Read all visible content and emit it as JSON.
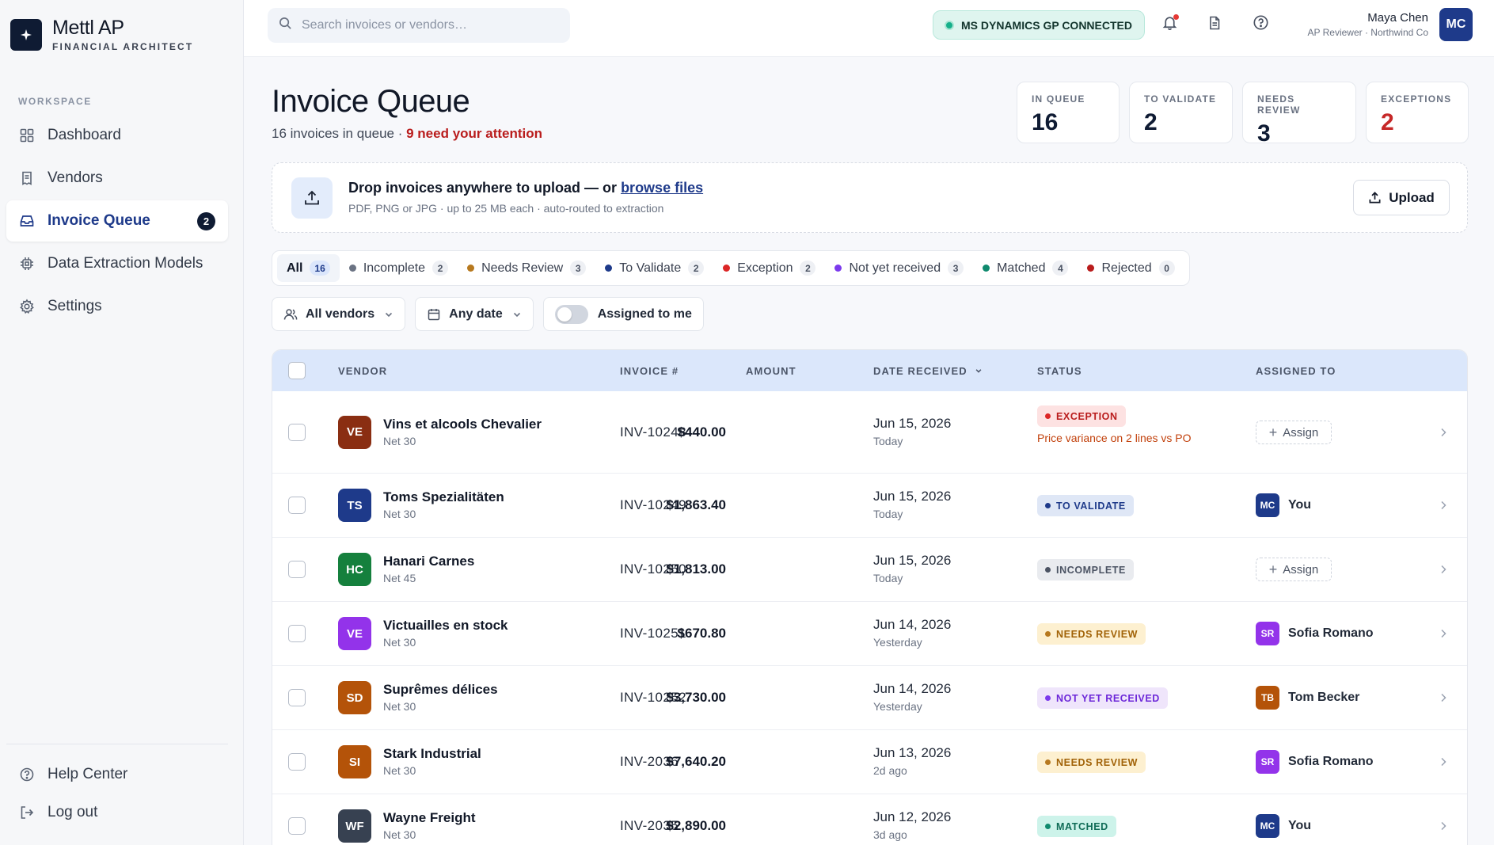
{
  "brand": {
    "name": "Mettl AP",
    "tagline": "FINANCIAL ARCHITECT"
  },
  "sidebar": {
    "section_label": "WORKSPACE",
    "items": [
      {
        "label": "Dashboard",
        "icon": "grid-icon"
      },
      {
        "label": "Vendors",
        "icon": "receipt-icon"
      },
      {
        "label": "Invoice Queue",
        "icon": "inbox-icon",
        "badge": "2",
        "active": true
      },
      {
        "label": "Data Extraction Models",
        "icon": "cpu-icon"
      },
      {
        "label": "Settings",
        "icon": "gear-icon"
      }
    ],
    "bottom": [
      {
        "label": "Help Center",
        "icon": "help-icon"
      },
      {
        "label": "Log out",
        "icon": "logout-icon"
      }
    ]
  },
  "topbar": {
    "search_placeholder": "Search invoices or vendors…",
    "connection": "MS DYNAMICS GP CONNECTED",
    "user": {
      "name": "Maya Chen",
      "role": "AP Reviewer · Northwind Co",
      "initials": "MC"
    }
  },
  "header": {
    "title": "Invoice Queue",
    "subtitle_count": "16 invoices in queue · ",
    "subtitle_attention": "9 need your attention"
  },
  "stats": [
    {
      "label": "IN QUEUE",
      "value": "16",
      "color": "#0f1b33"
    },
    {
      "label": "TO VALIDATE",
      "value": "2",
      "color": "#0f1b33"
    },
    {
      "label": "NEEDS REVIEW",
      "value": "3",
      "color": "#0f1b33"
    },
    {
      "label": "EXCEPTIONS",
      "value": "2",
      "color": "#c62828"
    }
  ],
  "upload": {
    "title": "Drop invoices anywhere to upload — or ",
    "link": "browse files",
    "subtitle": "PDF, PNG or JPG · up to 25 MB each · auto-routed to extraction",
    "button": "Upload"
  },
  "tabs": [
    {
      "label": "All",
      "count": "16",
      "active": true
    },
    {
      "label": "Incomplete",
      "count": "2",
      "dot": "#6b7383"
    },
    {
      "label": "Needs Review",
      "count": "3",
      "dot": "#b7791f"
    },
    {
      "label": "To Validate",
      "count": "2",
      "dot": "#1e3a8a"
    },
    {
      "label": "Exception",
      "count": "2",
      "dot": "#dc2626"
    },
    {
      "label": "Not yet received",
      "count": "3",
      "dot": "#7c3aed"
    },
    {
      "label": "Matched",
      "count": "4",
      "dot": "#0f8a6e"
    },
    {
      "label": "Rejected",
      "count": "0",
      "dot": "#b91c1c"
    }
  ],
  "filters": {
    "vendor": "All vendors",
    "date": "Any date",
    "assigned": "Assigned to me"
  },
  "table": {
    "columns": {
      "vendor": "VENDOR",
      "invoice": "INVOICE #",
      "amount": "AMOUNT",
      "date": "DATE RECEIVED",
      "status": "STATUS",
      "assigned": "ASSIGNED TO"
    },
    "assign_label": "Assign",
    "rows": [
      {
        "initials": "VE",
        "avatar_color": "#8a2e12",
        "vendor": "Vins et alcools Chevalier",
        "terms": "Net 30",
        "invoice": "INV-10248",
        "amount": "$440.00",
        "date": "Jun 15, 2026",
        "relative": "Today",
        "status": "EXCEPTION",
        "status_bg": "#fde2e2",
        "status_fg": "#b91c1c",
        "note": "Price variance on 2 lines vs PO",
        "assignee": null
      },
      {
        "initials": "TS",
        "avatar_color": "#1e3a8a",
        "vendor": "Toms Spezialitäten",
        "terms": "Net 30",
        "invoice": "INV-10249",
        "amount": "$1,863.40",
        "date": "Jun 15, 2026",
        "relative": "Today",
        "status": "TO VALIDATE",
        "status_bg": "#dfe7f6",
        "status_fg": "#1e3a8a",
        "assignee": {
          "initials": "MC",
          "name": "You",
          "color": "#1e3a8a"
        }
      },
      {
        "initials": "HC",
        "avatar_color": "#15803d",
        "vendor": "Hanari Carnes",
        "terms": "Net 45",
        "invoice": "INV-10250",
        "amount": "$1,813.00",
        "date": "Jun 15, 2026",
        "relative": "Today",
        "status": "INCOMPLETE",
        "status_bg": "#e9ebef",
        "status_fg": "#4b5363",
        "assignee": null
      },
      {
        "initials": "VE",
        "avatar_color": "#9333ea",
        "vendor": "Victuailles en stock",
        "terms": "Net 30",
        "invoice": "INV-10251",
        "amount": "$670.80",
        "date": "Jun 14, 2026",
        "relative": "Yesterday",
        "status": "NEEDS REVIEW",
        "status_bg": "#fdf0d0",
        "status_fg": "#a16207",
        "assignee": {
          "initials": "SR",
          "name": "Sofia Romano",
          "color": "#9333ea"
        }
      },
      {
        "initials": "SD",
        "avatar_color": "#b45309",
        "vendor": "Suprêmes délices",
        "terms": "Net 30",
        "invoice": "INV-10252",
        "amount": "$3,730.00",
        "date": "Jun 14, 2026",
        "relative": "Yesterday",
        "status": "NOT YET RECEIVED",
        "status_bg": "#efe5fb",
        "status_fg": "#6d28d9",
        "assignee": {
          "initials": "TB",
          "name": "Tom Becker",
          "color": "#b45309"
        }
      },
      {
        "initials": "SI",
        "avatar_color": "#b45309",
        "vendor": "Stark Industrial",
        "terms": "Net 30",
        "invoice": "INV-2036",
        "amount": "$7,640.20",
        "date": "Jun 13, 2026",
        "relative": "2d ago",
        "status": "NEEDS REVIEW",
        "status_bg": "#fdf0d0",
        "status_fg": "#a16207",
        "assignee": {
          "initials": "SR",
          "name": "Sofia Romano",
          "color": "#9333ea"
        }
      },
      {
        "initials": "WF",
        "avatar_color": "#374151",
        "vendor": "Wayne Freight",
        "terms": "Net 30",
        "invoice": "INV-2035",
        "amount": "$2,890.00",
        "date": "Jun 12, 2026",
        "relative": "3d ago",
        "status": "MATCHED",
        "status_bg": "#cdf3ea",
        "status_fg": "#0f6b56",
        "assignee": {
          "initials": "MC",
          "name": "You",
          "color": "#1e3a8a"
        }
      }
    ]
  }
}
